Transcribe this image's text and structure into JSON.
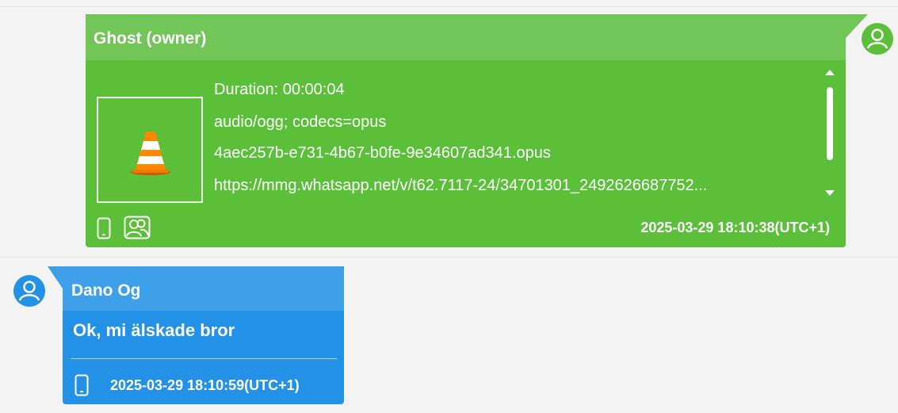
{
  "messages": [
    {
      "direction": "outgoing",
      "sender": "Ghost (owner)",
      "attachment": {
        "icon": "vlc-cone-icon",
        "duration": "Duration: 00:00:04",
        "mime": "audio/ogg; codecs=opus",
        "filename": "4aec257b-e731-4b67-b0fe-9e34607ad341.opus",
        "url": "https://mmg.whatsapp.net/v/t62.7117-24/34701301_2492626687752..."
      },
      "footer_icons": [
        "phone-icon",
        "contacts-icon"
      ],
      "timestamp": "2025-03-29 18:10:38(UTC+1)",
      "color": "#5bbf3a"
    },
    {
      "direction": "incoming",
      "sender": "Dano Og",
      "text": "Ok, mi älskade bror",
      "footer_icons": [
        "phone-icon"
      ],
      "timestamp": "2025-03-29 18:10:59(UTC+1)",
      "color": "#2291e6"
    }
  ]
}
